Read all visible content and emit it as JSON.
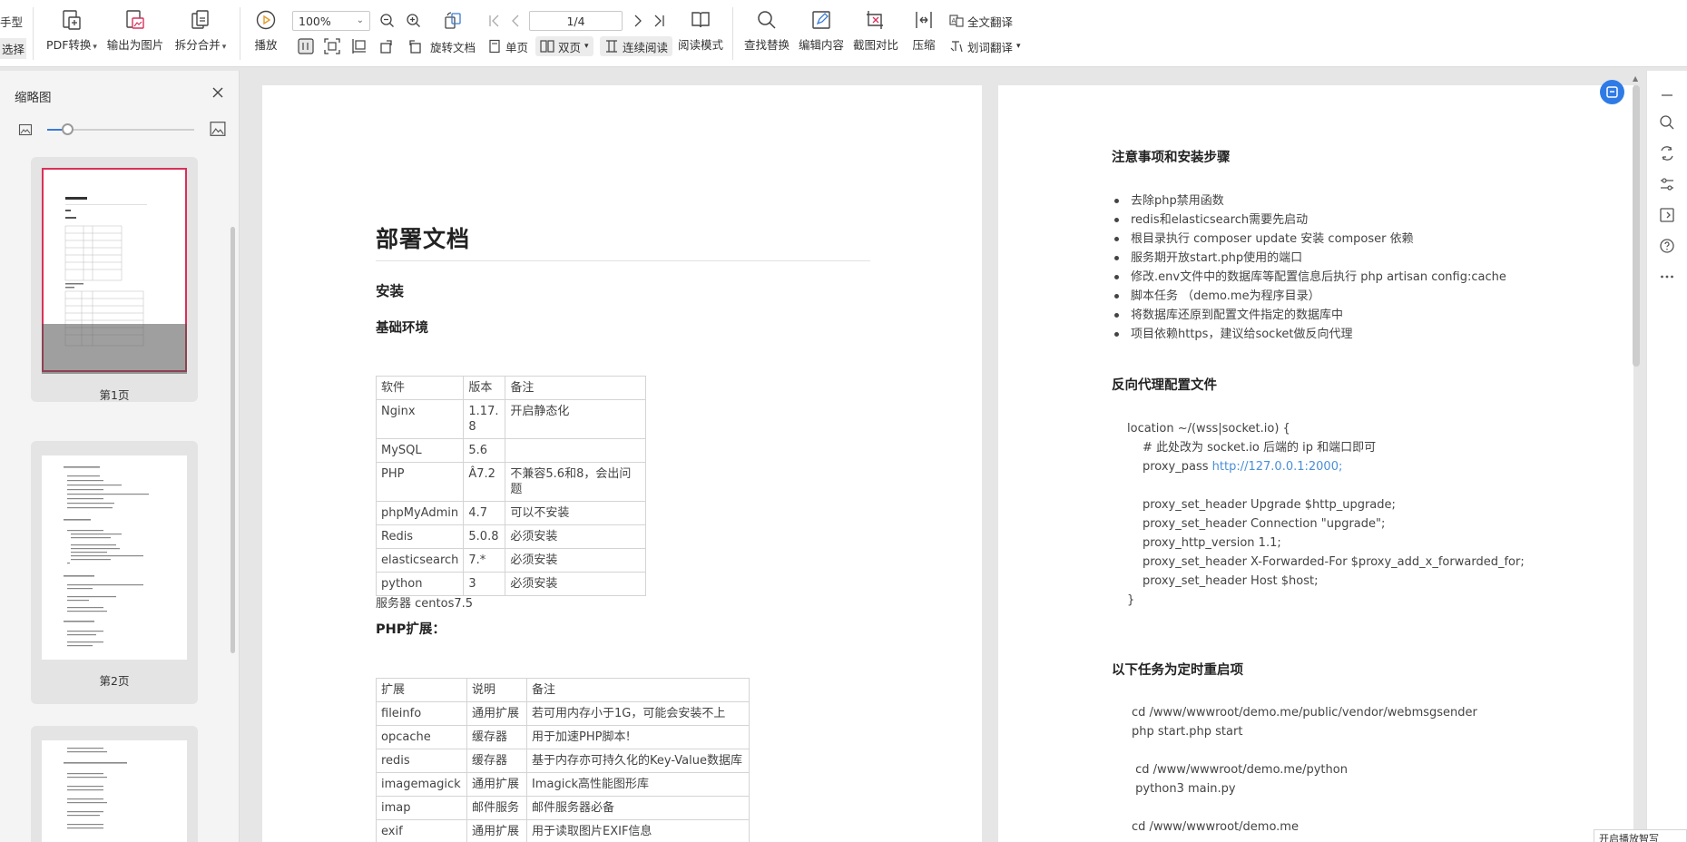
{
  "toolbar": {
    "left_labels": [
      "手型",
      "选择"
    ],
    "pdf_convert": "PDF转换",
    "export_image": "输出为图片",
    "split_merge": "拆分合并",
    "play": "播放",
    "zoom_value": "100%",
    "page_value": "1/4",
    "rotate_doc": "旋转文档",
    "single_page": "单页",
    "double_page": "双页",
    "continuous": "连续阅读",
    "reading_mode": "阅读模式",
    "find_replace": "查找替换",
    "edit_content": "编辑内容",
    "screenshot_compare": "截图对比",
    "compress": "压缩",
    "full_translate": "全文翻译",
    "word_translate": "划词翻译"
  },
  "sidebar": {
    "title": "缩略图",
    "pages": [
      {
        "label": "第1页"
      },
      {
        "label": "第2页"
      }
    ]
  },
  "page1": {
    "title": "部署文档",
    "h_install": "安装",
    "h_env": "基础环境",
    "env_table": [
      [
        "软件",
        "版本",
        "备注"
      ],
      [
        "Nginx",
        "1.17.8",
        "开启静态化"
      ],
      [
        "MySQL",
        "5.6",
        ""
      ],
      [
        "PHP",
        "Â7.2",
        "不兼容5.6和8，会出问题"
      ],
      [
        "phpMyAdmin",
        "4.7",
        "可以不安装"
      ],
      [
        "Redis",
        "5.0.8",
        "必须安装"
      ],
      [
        "elasticsearch",
        "7.*",
        "必须安装"
      ],
      [
        "python",
        "3",
        "必须安装"
      ]
    ],
    "server": "服务器 centos7.5",
    "h_ext": "PHP扩展：",
    "ext_table": [
      [
        "扩展",
        "说明",
        "备注"
      ],
      [
        "fileinfo",
        "通用扩展",
        "若可用内存小于1G，可能会安装不上"
      ],
      [
        "opcache",
        "缓存器",
        "用于加速PHP脚本!"
      ],
      [
        "redis",
        "缓存器",
        "基于内存亦可持久化的Key-Value数据库"
      ],
      [
        "imagemagick",
        "通用扩展",
        "Imagick高性能图形库"
      ],
      [
        "imap",
        "邮件服务",
        "邮件服务器必备"
      ],
      [
        "exif",
        "通用扩展",
        "用于读取图片EXIF信息"
      ]
    ]
  },
  "page2": {
    "h_notes": "注意事项和安装步骤",
    "notes": [
      "去除php禁用函数",
      "redis和elasticsearch需要先启动",
      "根目录执行 composer update 安装 composer 依赖",
      "服务期开放start.php使用的端口",
      "修改.env文件中的数据库等配置信息后执行 php artisan config:cache",
      "脚本任务 （demo.me为程序目录）",
      "将数据库还原到配置文件指定的数据库中",
      "项目依赖https，建议给socket做反向代理"
    ],
    "h_proxy": "反向代理配置文件",
    "proxy_code": [
      "location ~/(wss|socket.io) {",
      "# 此处改为 socket.io 后端的 ip 和端口即可",
      "proxy_pass ",
      "",
      "proxy_set_header Upgrade $http_upgrade;",
      "proxy_set_header Connection \"upgrade\";",
      "proxy_http_version 1.1;",
      "proxy_set_header X-Forwarded-For $proxy_add_x_forwarded_for;",
      "proxy_set_header Host $host;",
      "}"
    ],
    "proxy_link": "http://127.0.0.1:2000;",
    "h_tasks": "以下任务为定时重启项",
    "tasks_code": [
      "cd /www/wwwroot/demo.me/public/vendor/webmsgsender",
      "php start.php start",
      "",
      " cd /www/wwwroot/demo.me/python",
      " python3 main.py",
      "",
      "cd /www/wwwroot/demo.me"
    ]
  },
  "bottom_tip": "开启播放智写",
  "colors": {
    "accent": "#2f7be6",
    "link": "#4a8fd8",
    "thumb_selected": "#d8315b"
  }
}
